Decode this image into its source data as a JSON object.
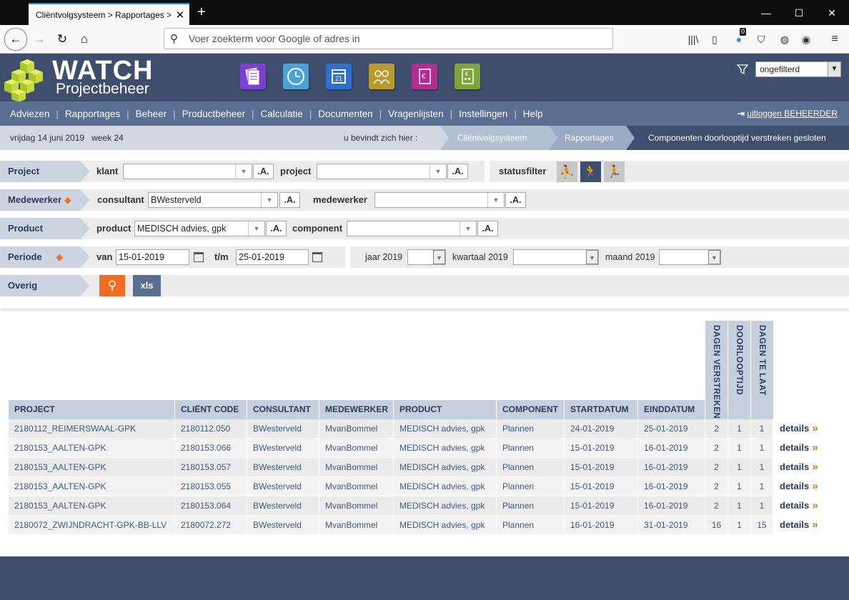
{
  "browser": {
    "tab_title": "Cliëntvolgsysteem > Rapportages > ",
    "url_placeholder": "Voer zoekterm voor Google of adres in",
    "badge_count": "0"
  },
  "app": {
    "logo_title": "WATCH",
    "logo_subtitle": "Projectbeheer",
    "filter_select": "ongefilterd"
  },
  "menu": [
    "Adviezen",
    "Rapportages",
    "Beheer",
    "Productbeheer",
    "Calculatie",
    "Documenten",
    "Vragenlijsten",
    "Instellingen",
    "Help"
  ],
  "logout_label": "uitloggen BEHEERDER",
  "crumb": {
    "date": "vrijdag 14 juni 2019",
    "week": "week 24",
    "here": "u bevindt zich hier :",
    "items": [
      "Cliëntvolgsysteem",
      "Rapportages",
      "Componenten doorlooptijd verstreken gesloten"
    ]
  },
  "filters": {
    "project_label": "Project",
    "klant_label": "klant",
    "klant_value": "",
    "project_field_label": "project",
    "project_value": "",
    "statusfilter_label": "statusfilter",
    "medewerker_row_label": "Medewerker",
    "consultant_label": "consultant",
    "consultant_value": "BWesterveld",
    "medewerker_label": "medewerker",
    "medewerker_value": "",
    "product_row_label": "Product",
    "product_label": "product",
    "product_value": "MEDISCH advies, gpk",
    "component_label": "component",
    "component_value": "",
    "periode_label": "Periode",
    "van_label": "van",
    "van_value": "15-01-2019",
    "tm_label": "t/m",
    "tm_value": "25-01-2019",
    "jaar_label": "jaar 2019",
    "kwartaal_label": "kwartaal 2019",
    "maand_label": "maand 2019",
    "overig_label": "Overig",
    "ab_label": ".A.",
    "xls_label": "xls"
  },
  "table": {
    "headers": [
      "PROJECT",
      "CLIËNT CODE",
      "CONSULTANT",
      "MEDEWERKER",
      "PRODUCT",
      "COMPONENT",
      "STARTDATUM",
      "EINDDATUM"
    ],
    "vheaders": [
      "DAGEN VERSTREKEN",
      "DOORLOOPTIJD",
      "DAGEN TE LAAT"
    ],
    "details_label": "details",
    "rows": [
      [
        "2180112_REIMERSWAAL-GPK",
        "2180112.050",
        "BWesterveld",
        "MvanBommel",
        "MEDISCH advies, gpk",
        "Plannen",
        "24-01-2019",
        "25-01-2019",
        "2",
        "1",
        "1"
      ],
      [
        "2180153_AALTEN-GPK",
        "2180153.066",
        "BWesterveld",
        "MvanBommel",
        "MEDISCH advies, gpk",
        "Plannen",
        "15-01-2019",
        "16-01-2019",
        "2",
        "1",
        "1"
      ],
      [
        "2180153_AALTEN-GPK",
        "2180153.057",
        "BWesterveld",
        "MvanBommel",
        "MEDISCH advies, gpk",
        "Plannen",
        "15-01-2019",
        "16-01-2019",
        "2",
        "1",
        "1"
      ],
      [
        "2180153_AALTEN-GPK",
        "2180153.055",
        "BWesterveld",
        "MvanBommel",
        "MEDISCH advies, gpk",
        "Plannen",
        "15-01-2019",
        "16-01-2019",
        "2",
        "1",
        "1"
      ],
      [
        "2180153_AALTEN-GPK",
        "2180153.064",
        "BWesterveld",
        "MvanBommel",
        "MEDISCH advies, gpk",
        "Plannen",
        "15-01-2019",
        "16-01-2019",
        "2",
        "1",
        "1"
      ],
      [
        "2180072_ZWIJNDRACHT-GPK-BB-LLV",
        "2180072.272",
        "BWesterveld",
        "MvanBommel",
        "MEDISCH advies, gpk",
        "Plannen",
        "16-01-2019",
        "31-01-2019",
        "16",
        "1",
        "15"
      ]
    ]
  },
  "colors": {
    "header_bg": "#3e4f6e",
    "menu_bg": "#5a6e91",
    "accent_orange": "#f26d21",
    "label_blue": "#ccd4e1"
  }
}
